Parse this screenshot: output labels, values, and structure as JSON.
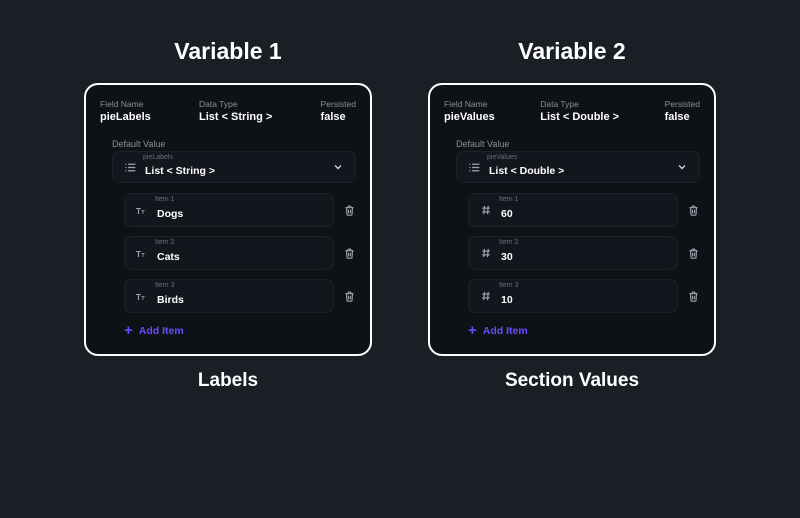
{
  "columns": [
    {
      "titleTop": "Variable 1",
      "titleBottom": "Labels",
      "header": {
        "fieldNameLabel": "Field Name",
        "fieldNameValue": "pieLabels",
        "dataTypeLabel": "Data Type",
        "dataTypeValue": "List < String >",
        "persistedLabel": "Persisted",
        "persistedValue": "false"
      },
      "defaultLabel": "Default Value",
      "typeMini": "pieLabels",
      "typeText": "List < String >",
      "itemIcon": "text",
      "items": [
        {
          "label": "Item 1",
          "value": "Dogs"
        },
        {
          "label": "Item 2",
          "value": "Cats"
        },
        {
          "label": "Item 3",
          "value": "Birds"
        }
      ],
      "addLabel": "Add Item"
    },
    {
      "titleTop": "Variable 2",
      "titleBottom": "Section Values",
      "header": {
        "fieldNameLabel": "Field Name",
        "fieldNameValue": "pieValues",
        "dataTypeLabel": "Data Type",
        "dataTypeValue": "List < Double >",
        "persistedLabel": "Persisted",
        "persistedValue": "false"
      },
      "defaultLabel": "Default Value",
      "typeMini": "pieValues",
      "typeText": "List < Double >",
      "itemIcon": "number",
      "items": [
        {
          "label": "Item 1",
          "value": "60"
        },
        {
          "label": "Item 2",
          "value": "30"
        },
        {
          "label": "Item 3",
          "value": "10"
        }
      ],
      "addLabel": "Add Item"
    }
  ]
}
